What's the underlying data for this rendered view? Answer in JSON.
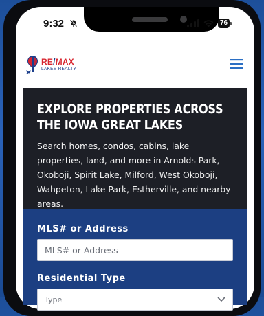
{
  "status_bar": {
    "time": "9:32",
    "battery": "76"
  },
  "header": {
    "logo_brand_re": "RE",
    "logo_brand_slash": "/",
    "logo_brand_max": "MAX",
    "logo_subtitle": "LAKES REALTY"
  },
  "hero": {
    "title": "EXPLORE PROPERTIES ACROSS THE IOWA GREAT LAKES",
    "description": "Search homes, condos, cabins, lake properties, land, and more in Arnolds Park, Okoboji, Spirit Lake, Milford, West Okoboji, Wahpeton, Lake Park, Estherville, and nearby areas."
  },
  "search": {
    "mls_label": "MLS# or Address",
    "mls_placeholder": "MLS# or Address",
    "type_label": "Residential Type",
    "type_placeholder": "Type"
  },
  "colors": {
    "brand_red": "#d8252f",
    "brand_blue": "#1c3f8c",
    "hero_bg": "#1d1f26",
    "search_bg": "#1c3f82",
    "menu_blue": "#2b6fc4"
  }
}
